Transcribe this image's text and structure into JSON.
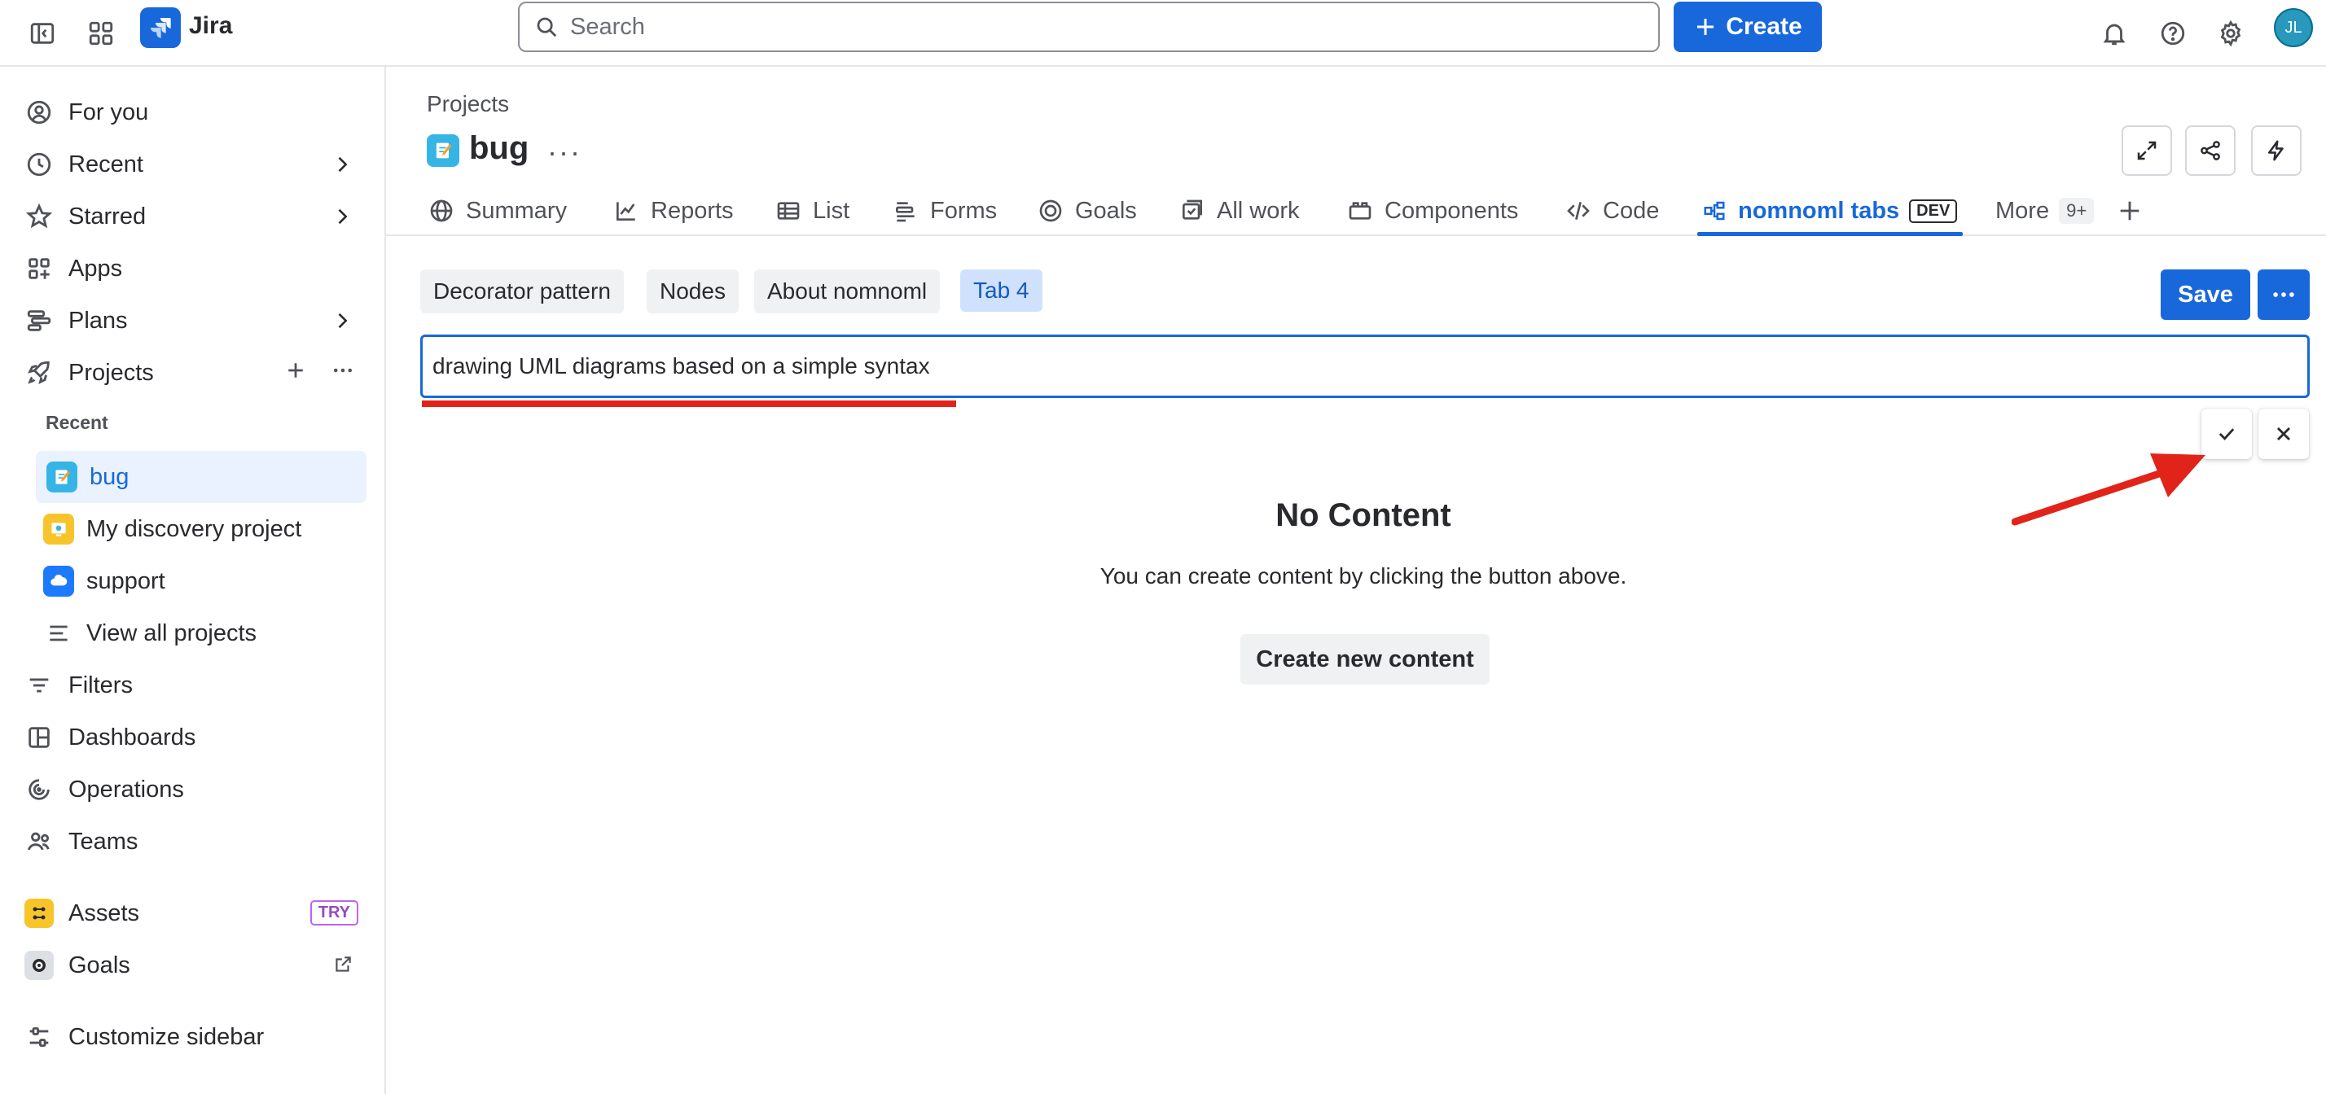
{
  "topbar": {
    "app_name": "Jira",
    "search_placeholder": "Search",
    "create_label": "Create",
    "user_initials": "JL",
    "icons": [
      "sidebar-toggle-icon",
      "app-switcher-icon",
      "bell-icon",
      "help-icon",
      "gear-icon"
    ]
  },
  "sidebar": {
    "items": [
      {
        "label": "For you",
        "icon": "person-icon"
      },
      {
        "label": "Recent",
        "icon": "clock-icon"
      },
      {
        "label": "Starred",
        "icon": "star-icon"
      },
      {
        "label": "Apps",
        "icon": "apps-icon"
      },
      {
        "label": "Plans",
        "icon": "plans-icon"
      },
      {
        "label": "Projects",
        "icon": "rocket-icon"
      }
    ],
    "recent_section": "Recent",
    "projects": [
      {
        "label": "bug",
        "color": "#37b4e6"
      },
      {
        "label": "My discovery project",
        "color": "#f8c42c"
      },
      {
        "label": "support",
        "color": "#1d7afc"
      }
    ],
    "view_all": "View all projects",
    "lower_items": [
      {
        "label": "Filters",
        "icon": "filter-icon"
      },
      {
        "label": "Dashboards",
        "icon": "dashboard-icon"
      },
      {
        "label": "Operations",
        "icon": "operations-icon"
      },
      {
        "label": "Teams",
        "icon": "teams-icon"
      }
    ],
    "assets": {
      "label": "Assets",
      "badge": "TRY"
    },
    "goals": {
      "label": "Goals"
    },
    "customize": "Customize sidebar"
  },
  "main": {
    "breadcrumb": "Projects",
    "project_title": "bug",
    "project_more": "···",
    "tabs": [
      {
        "label": "Summary",
        "icon": "globe-icon"
      },
      {
        "label": "Reports",
        "icon": "chart-line-icon"
      },
      {
        "label": "List",
        "icon": "list-icon"
      },
      {
        "label": "Forms",
        "icon": "forms-icon"
      },
      {
        "label": "Goals",
        "icon": "target-icon"
      },
      {
        "label": "All work",
        "icon": "all-work-icon"
      },
      {
        "label": "Components",
        "icon": "components-icon"
      },
      {
        "label": "Code",
        "icon": "code-icon"
      },
      {
        "label": "nomnoml tabs",
        "icon": "diagram-icon",
        "badge": "DEV",
        "active": true
      },
      {
        "label": "More",
        "badge": "9+"
      }
    ],
    "nomnoml_tabs": [
      "Decorator pattern",
      "Nodes",
      "About nomnoml",
      "Tab 4"
    ],
    "active_nomnoml_tab": "Tab 4",
    "save_label": "Save",
    "edit_value": "drawing UML diagrams based on a simple syntax",
    "empty_title": "No Content",
    "empty_desc": "You can create content by clicking the button above.",
    "create_content_label": "Create new content"
  },
  "colors": {
    "brand": "#1868db",
    "annotation_red": "#e2231a",
    "selected_bg": "#e9f2fe"
  }
}
